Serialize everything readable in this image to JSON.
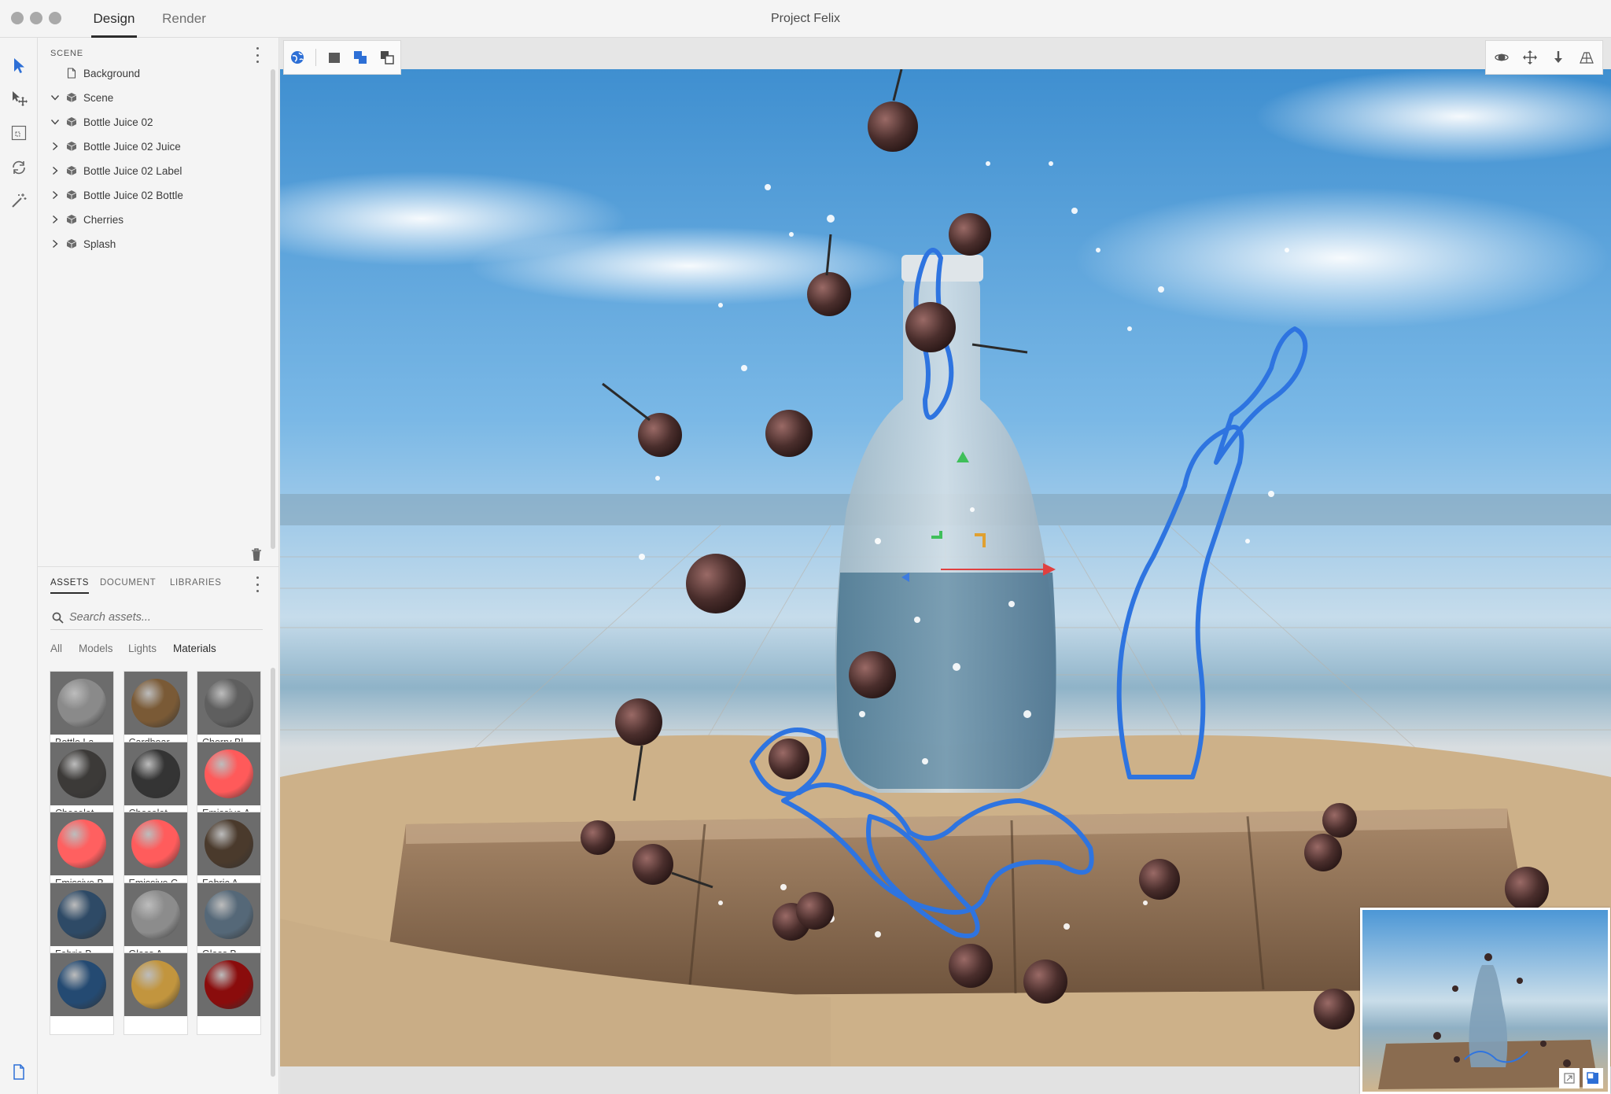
{
  "window": {
    "title": "Project Felix",
    "tabs": [
      {
        "label": "Design",
        "active": true
      },
      {
        "label": "Render",
        "active": false
      }
    ]
  },
  "tools": [
    "select-arrow-icon",
    "move-select-icon",
    "marquee-icon",
    "orbit-icon",
    "magic-wand-icon"
  ],
  "scene": {
    "heading": "SCENE",
    "items": [
      {
        "label": "Background",
        "icon": "document-icon",
        "expander": "none"
      },
      {
        "label": "Scene",
        "icon": "cube-icon",
        "expander": "expanded"
      },
      {
        "label": "Bottle Juice 02",
        "icon": "cube-icon",
        "expander": "expanded"
      },
      {
        "label": "Bottle Juice 02 Juice",
        "icon": "cube-icon",
        "expander": "collapsed"
      },
      {
        "label": "Bottle Juice 02 Label",
        "icon": "cube-icon",
        "expander": "collapsed"
      },
      {
        "label": "Bottle Juice 02 Bottle",
        "icon": "cube-icon",
        "expander": "collapsed"
      },
      {
        "label": "Cherries",
        "icon": "cube-icon",
        "expander": "collapsed"
      },
      {
        "label": "Splash",
        "icon": "cube-icon",
        "expander": "collapsed"
      }
    ]
  },
  "assets": {
    "tabs": [
      {
        "label": "ASSETS",
        "active": true
      },
      {
        "label": "DOCUMENT",
        "active": false
      },
      {
        "label": "LIBRARIES",
        "active": false
      }
    ],
    "search_placeholder": "Search assets...",
    "filters": [
      {
        "label": "All",
        "active": false
      },
      {
        "label": "Models",
        "active": false
      },
      {
        "label": "Lights",
        "active": false
      },
      {
        "label": "Materials",
        "active": true
      }
    ],
    "materials": [
      {
        "label": "Bottle La...",
        "color": "#8a8a8a"
      },
      {
        "label": "Cardboar...",
        "color": "#7a5a36"
      },
      {
        "label": "Cherry Bl...",
        "color": "#5f5f5f"
      },
      {
        "label": "Chocolat...",
        "color": "#3c3a38"
      },
      {
        "label": "Chocolat...",
        "color": "#343434"
      },
      {
        "label": "Emissive A",
        "color": "#ff5a5a"
      },
      {
        "label": "Emissive B",
        "color": "#ff6060"
      },
      {
        "label": "Emissive C",
        "color": "#ff5c5c"
      },
      {
        "label": "Fabric A",
        "color": "#4a3a2c"
      },
      {
        "label": "Fabric B",
        "color": "#2e4a66"
      },
      {
        "label": "Glass A",
        "color": "#8c8c8c"
      },
      {
        "label": "Glass B",
        "color": "#556878"
      },
      {
        "label": "",
        "color": "#244a72"
      },
      {
        "label": "",
        "color": "#c2953e"
      },
      {
        "label": "",
        "color": "#8a0c0c"
      }
    ]
  },
  "viewport": {
    "left_tools": [
      "globe-icon",
      "solid-square-icon",
      "overlap-squares-icon",
      "subtract-squares-icon"
    ],
    "right_tools": [
      "orbit-camera-icon",
      "pan-icon",
      "drop-to-ground-icon",
      "perspective-icon"
    ],
    "minimap_tools": [
      "expand-icon",
      "toggle-view-icon"
    ],
    "accent_color": "#2d6fd6"
  }
}
